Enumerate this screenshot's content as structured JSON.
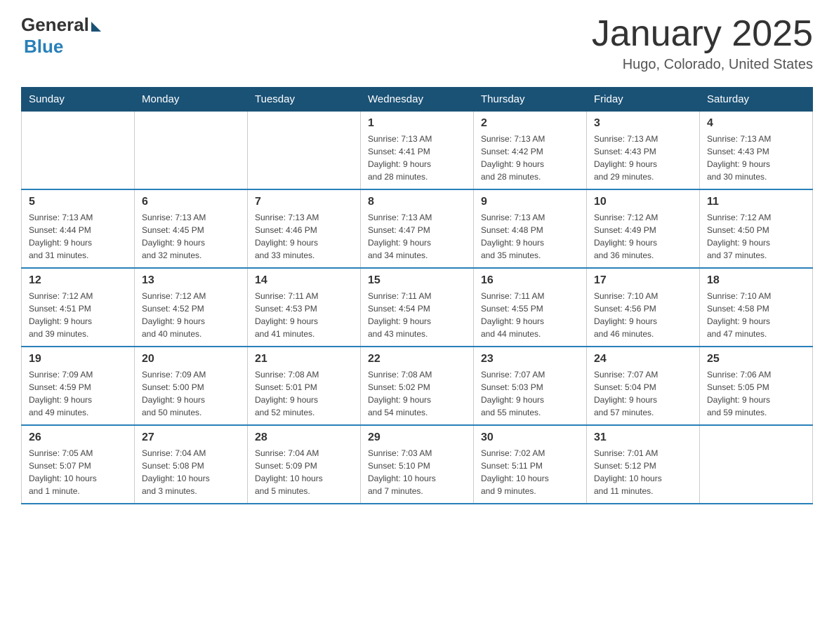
{
  "logo": {
    "general": "General",
    "blue": "Blue"
  },
  "title": {
    "month": "January 2025",
    "location": "Hugo, Colorado, United States"
  },
  "weekdays": [
    "Sunday",
    "Monday",
    "Tuesday",
    "Wednesday",
    "Thursday",
    "Friday",
    "Saturday"
  ],
  "rows": [
    [
      {
        "day": "",
        "info": ""
      },
      {
        "day": "",
        "info": ""
      },
      {
        "day": "",
        "info": ""
      },
      {
        "day": "1",
        "info": "Sunrise: 7:13 AM\nSunset: 4:41 PM\nDaylight: 9 hours\nand 28 minutes."
      },
      {
        "day": "2",
        "info": "Sunrise: 7:13 AM\nSunset: 4:42 PM\nDaylight: 9 hours\nand 28 minutes."
      },
      {
        "day": "3",
        "info": "Sunrise: 7:13 AM\nSunset: 4:43 PM\nDaylight: 9 hours\nand 29 minutes."
      },
      {
        "day": "4",
        "info": "Sunrise: 7:13 AM\nSunset: 4:43 PM\nDaylight: 9 hours\nand 30 minutes."
      }
    ],
    [
      {
        "day": "5",
        "info": "Sunrise: 7:13 AM\nSunset: 4:44 PM\nDaylight: 9 hours\nand 31 minutes."
      },
      {
        "day": "6",
        "info": "Sunrise: 7:13 AM\nSunset: 4:45 PM\nDaylight: 9 hours\nand 32 minutes."
      },
      {
        "day": "7",
        "info": "Sunrise: 7:13 AM\nSunset: 4:46 PM\nDaylight: 9 hours\nand 33 minutes."
      },
      {
        "day": "8",
        "info": "Sunrise: 7:13 AM\nSunset: 4:47 PM\nDaylight: 9 hours\nand 34 minutes."
      },
      {
        "day": "9",
        "info": "Sunrise: 7:13 AM\nSunset: 4:48 PM\nDaylight: 9 hours\nand 35 minutes."
      },
      {
        "day": "10",
        "info": "Sunrise: 7:12 AM\nSunset: 4:49 PM\nDaylight: 9 hours\nand 36 minutes."
      },
      {
        "day": "11",
        "info": "Sunrise: 7:12 AM\nSunset: 4:50 PM\nDaylight: 9 hours\nand 37 minutes."
      }
    ],
    [
      {
        "day": "12",
        "info": "Sunrise: 7:12 AM\nSunset: 4:51 PM\nDaylight: 9 hours\nand 39 minutes."
      },
      {
        "day": "13",
        "info": "Sunrise: 7:12 AM\nSunset: 4:52 PM\nDaylight: 9 hours\nand 40 minutes."
      },
      {
        "day": "14",
        "info": "Sunrise: 7:11 AM\nSunset: 4:53 PM\nDaylight: 9 hours\nand 41 minutes."
      },
      {
        "day": "15",
        "info": "Sunrise: 7:11 AM\nSunset: 4:54 PM\nDaylight: 9 hours\nand 43 minutes."
      },
      {
        "day": "16",
        "info": "Sunrise: 7:11 AM\nSunset: 4:55 PM\nDaylight: 9 hours\nand 44 minutes."
      },
      {
        "day": "17",
        "info": "Sunrise: 7:10 AM\nSunset: 4:56 PM\nDaylight: 9 hours\nand 46 minutes."
      },
      {
        "day": "18",
        "info": "Sunrise: 7:10 AM\nSunset: 4:58 PM\nDaylight: 9 hours\nand 47 minutes."
      }
    ],
    [
      {
        "day": "19",
        "info": "Sunrise: 7:09 AM\nSunset: 4:59 PM\nDaylight: 9 hours\nand 49 minutes."
      },
      {
        "day": "20",
        "info": "Sunrise: 7:09 AM\nSunset: 5:00 PM\nDaylight: 9 hours\nand 50 minutes."
      },
      {
        "day": "21",
        "info": "Sunrise: 7:08 AM\nSunset: 5:01 PM\nDaylight: 9 hours\nand 52 minutes."
      },
      {
        "day": "22",
        "info": "Sunrise: 7:08 AM\nSunset: 5:02 PM\nDaylight: 9 hours\nand 54 minutes."
      },
      {
        "day": "23",
        "info": "Sunrise: 7:07 AM\nSunset: 5:03 PM\nDaylight: 9 hours\nand 55 minutes."
      },
      {
        "day": "24",
        "info": "Sunrise: 7:07 AM\nSunset: 5:04 PM\nDaylight: 9 hours\nand 57 minutes."
      },
      {
        "day": "25",
        "info": "Sunrise: 7:06 AM\nSunset: 5:05 PM\nDaylight: 9 hours\nand 59 minutes."
      }
    ],
    [
      {
        "day": "26",
        "info": "Sunrise: 7:05 AM\nSunset: 5:07 PM\nDaylight: 10 hours\nand 1 minute."
      },
      {
        "day": "27",
        "info": "Sunrise: 7:04 AM\nSunset: 5:08 PM\nDaylight: 10 hours\nand 3 minutes."
      },
      {
        "day": "28",
        "info": "Sunrise: 7:04 AM\nSunset: 5:09 PM\nDaylight: 10 hours\nand 5 minutes."
      },
      {
        "day": "29",
        "info": "Sunrise: 7:03 AM\nSunset: 5:10 PM\nDaylight: 10 hours\nand 7 minutes."
      },
      {
        "day": "30",
        "info": "Sunrise: 7:02 AM\nSunset: 5:11 PM\nDaylight: 10 hours\nand 9 minutes."
      },
      {
        "day": "31",
        "info": "Sunrise: 7:01 AM\nSunset: 5:12 PM\nDaylight: 10 hours\nand 11 minutes."
      },
      {
        "day": "",
        "info": ""
      }
    ]
  ]
}
